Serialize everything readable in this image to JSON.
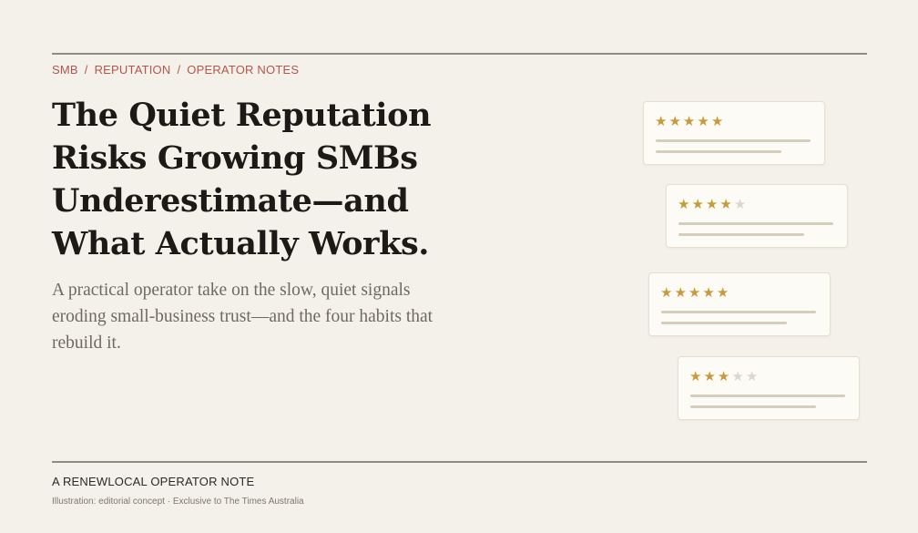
{
  "breadcrumb": {
    "items": [
      "SMB",
      "REPUTATION",
      "OPERATOR NOTES"
    ],
    "separator": "/"
  },
  "headline": {
    "lines": [
      "The Quiet Reputation",
      "Risks Growing SMBs",
      "Underestimate—and",
      "What Actually Works."
    ]
  },
  "dek": {
    "lines": [
      "A practical operator take on the slow, quiet signals",
      "eroding small-business trust—and the four habits that",
      "rebuild it."
    ]
  },
  "review_cards": [
    {
      "rating": 5,
      "max": 5
    },
    {
      "rating": 4,
      "max": 5
    },
    {
      "rating": 5,
      "max": 5
    },
    {
      "rating": 3,
      "max": 5
    }
  ],
  "footer": {
    "label": "A RENEWLOCAL OPERATOR NOTE",
    "credit": "Illustration: editorial concept · Exclusive to The Times Australia"
  },
  "colors": {
    "background": "#f4f0ea",
    "accent": "#b4574a",
    "star_filled": "#c99a3b",
    "star_empty": "#dcd7cc",
    "rule": "#8f8a82"
  },
  "icons": {
    "star": "star-icon"
  }
}
